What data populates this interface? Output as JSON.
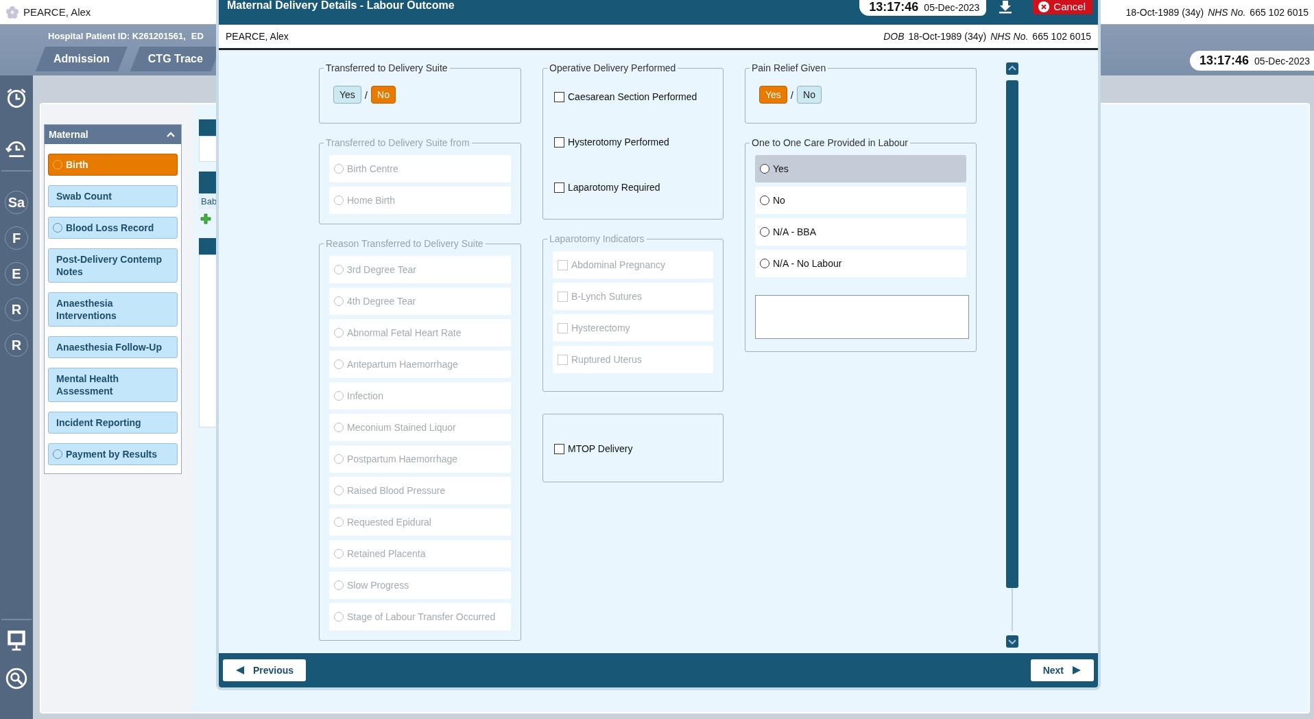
{
  "background": {
    "patient_name": "PEARCE, Alex",
    "dob": "18-Oct-1989 (34y)",
    "nhs_label": "NHS No.",
    "nhs_number": "665 102 6015",
    "patient_id": "Hospital Patient ID: K261201561,",
    "patient_id_cut": "ED",
    "tabs": [
      {
        "label": "Admission",
        "selected": false
      },
      {
        "label": "CTG Trace",
        "selected": false
      }
    ],
    "clock": {
      "time": "13:17:46",
      "date": "05-Dec-2023"
    },
    "rail": [
      "Sa",
      "F",
      "E",
      "R",
      "R"
    ],
    "menu": {
      "title": "Maternal",
      "expanded": true,
      "items": [
        {
          "label": "Birth",
          "kind": "radio",
          "selected": true
        },
        {
          "label": "Swab Count",
          "kind": "plain",
          "selected": false
        },
        {
          "label": "Blood Loss Record",
          "kind": "radio",
          "selected": false
        },
        {
          "label": "Post-Delivery Contemp Notes",
          "kind": "plain",
          "selected": false
        },
        {
          "label": "Anaesthesia Interventions",
          "kind": "plain",
          "selected": false
        },
        {
          "label": "Anaesthesia Follow-Up",
          "kind": "plain",
          "selected": false
        },
        {
          "label": "Mental Health Assessment",
          "kind": "plain",
          "selected": false
        },
        {
          "label": "Incident Reporting",
          "kind": "plain",
          "selected": false
        },
        {
          "label": "Payment by Results",
          "kind": "radio",
          "selected": false
        }
      ]
    },
    "behind_text": "Bab"
  },
  "modal": {
    "title": "Maternal Delivery Details - Labour Outcome",
    "clock": {
      "time": "13:17:46",
      "date": "05-Dec-2023"
    },
    "cancel": "Cancel",
    "patient_name": "PEARCE, Alex",
    "dob_label": "DOB",
    "dob": "18-Oct-1989 (34y)",
    "nhs_label": "NHS No.",
    "nhs_number": "665 102 6015",
    "columns": [
      [
        {
          "kind": "toggle",
          "legend": "Transferred to Delivery Suite",
          "disabled": false,
          "separator": "/",
          "options": [
            {
              "label": "Yes",
              "selected": false
            },
            {
              "label": "No",
              "selected": true
            }
          ]
        },
        {
          "kind": "radio",
          "legend": "Transferred to Delivery Suite from",
          "disabled": true,
          "options": [
            {
              "label": "Birth Centre",
              "selected": false
            },
            {
              "label": "Home Birth",
              "selected": false
            }
          ]
        },
        {
          "kind": "radio",
          "legend": "Reason Transferred to Delivery Suite",
          "disabled": true,
          "options": [
            {
              "label": "3rd Degree Tear",
              "selected": false
            },
            {
              "label": "4th Degree Tear",
              "selected": false
            },
            {
              "label": "Abnormal Fetal Heart Rate",
              "selected": false
            },
            {
              "label": "Antepartum Haemorrhage",
              "selected": false
            },
            {
              "label": "Infection",
              "selected": false
            },
            {
              "label": "Meconium Stained Liquor",
              "selected": false
            },
            {
              "label": "Postpartum Haemorrhage",
              "selected": false
            },
            {
              "label": "Raised Blood Pressure",
              "selected": false
            },
            {
              "label": "Requested Epidural",
              "selected": false
            },
            {
              "label": "Retained Placenta",
              "selected": false
            },
            {
              "label": "Slow Progress",
              "selected": false
            },
            {
              "label": "Stage of Labour Transfer Occurred",
              "selected": false
            }
          ]
        }
      ],
      [
        {
          "kind": "checkbox",
          "legend": "Operative Delivery Performed",
          "disabled": false,
          "options": [
            {
              "label": "Caesarean Section Performed",
              "checked": false
            },
            {
              "label": "Hysterotomy Performed",
              "checked": false
            },
            {
              "label": "Laparotomy Required",
              "checked": false
            }
          ]
        },
        {
          "kind": "checkbox",
          "legend": "Laparotomy Indicators",
          "disabled": true,
          "options": [
            {
              "label": "Abdominal Pregnancy",
              "checked": false
            },
            {
              "label": "B-Lynch Sutures",
              "checked": false
            },
            {
              "label": "Hysterectomy",
              "checked": false
            },
            {
              "label": "Ruptured Uterus",
              "checked": false
            }
          ]
        },
        {
          "kind": "checkbox",
          "disabled": false,
          "options": [
            {
              "label": "MTOP Delivery",
              "checked": false
            }
          ]
        }
      ],
      [
        {
          "kind": "toggle",
          "legend": "Pain Relief Given",
          "disabled": false,
          "separator": "/",
          "options": [
            {
              "label": "Yes",
              "selected": true
            },
            {
              "label": "No",
              "selected": false
            }
          ]
        },
        {
          "kind": "radio",
          "legend": "One to One Care Provided in Labour",
          "disabled": false,
          "note_box": true,
          "options": [
            {
              "label": "Yes",
              "selected": false,
              "highlighted": true
            },
            {
              "label": "No",
              "selected": false,
              "highlighted": false
            },
            {
              "label": "N/A - BBA",
              "selected": false,
              "highlighted": false
            },
            {
              "label": "N/A - No Labour",
              "selected": false,
              "highlighted": false
            }
          ]
        }
      ]
    ],
    "footer": {
      "previous": "Previous",
      "next": "Next"
    }
  }
}
